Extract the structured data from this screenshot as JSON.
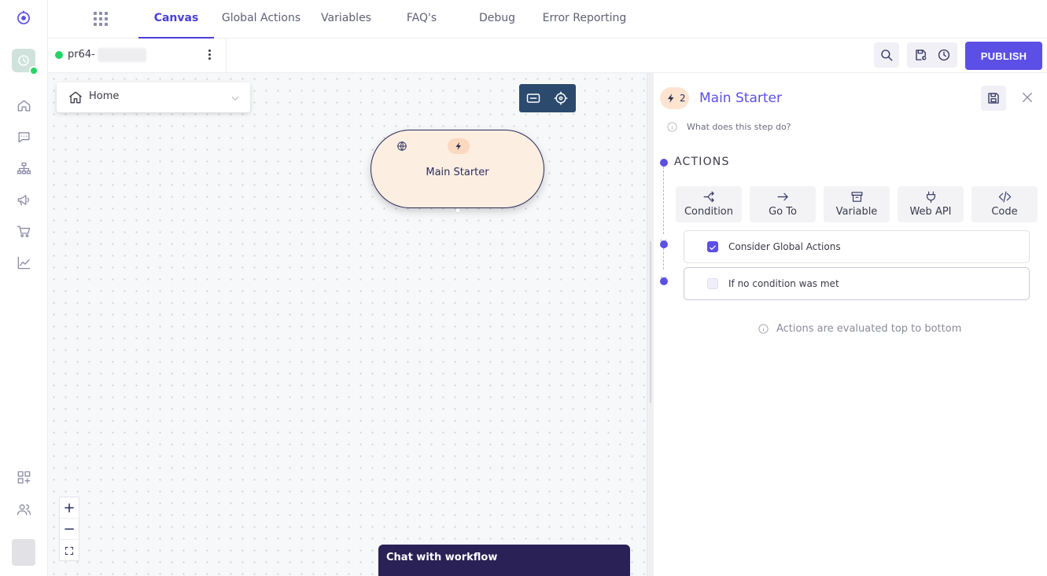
{
  "nav_tabs": [
    {
      "label": "Canvas",
      "active": true
    },
    {
      "label": "Global Actions",
      "active": false
    },
    {
      "label": "Variables",
      "active": false
    },
    {
      "label": "FAQ's",
      "active": false
    },
    {
      "label": "Debug",
      "active": false
    },
    {
      "label": "Error Reporting",
      "active": false
    }
  ],
  "bot": {
    "name_prefix": "pr64-"
  },
  "toolbar": {
    "publish_label": "PUBLISH"
  },
  "canvas": {
    "flow_selector": "Home",
    "node_title": "Main Starter",
    "chat_label": "Chat with workflow"
  },
  "panel": {
    "step_count": "2",
    "title": "Main Starter",
    "help_text": "What does this step do?",
    "actions_heading": "ACTIONS",
    "action_buttons": [
      {
        "label": "Condition",
        "icon": "condition-icon"
      },
      {
        "label": "Go To",
        "icon": "arrow-right-icon"
      },
      {
        "label": "Variable",
        "icon": "archive-icon"
      },
      {
        "label": "Web API",
        "icon": "plug-icon"
      },
      {
        "label": "Code",
        "icon": "code-icon"
      }
    ],
    "rows": [
      {
        "label": "Consider Global Actions",
        "checked": true
      },
      {
        "label": "If no condition was met",
        "checked": false
      }
    ],
    "eval_note": "Actions are evaluated top to bottom"
  },
  "colors": {
    "accent": "#5b4fe6",
    "node_fill": "#fdeee2",
    "chat_bg": "#2a2156",
    "canvas_tools_bg": "#2c4a6e"
  }
}
